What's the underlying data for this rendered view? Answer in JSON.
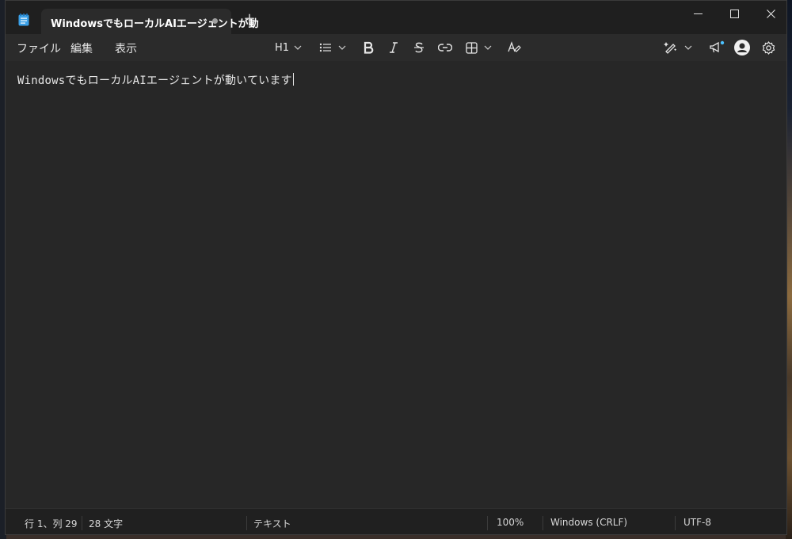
{
  "tab": {
    "title": "WindowsでもローカルAIエージェントが動"
  },
  "new_tab_label": "+",
  "menu": [
    "ファイル",
    "編集",
    "表示"
  ],
  "toolbar": {
    "heading_label": "H1"
  },
  "editor": {
    "text": "WindowsでもローカルAIエージェントが動いています"
  },
  "status": {
    "position": "行 1、列 29",
    "chars": "28 文字",
    "format": "テキスト",
    "zoom": "100%",
    "line_ending": "Windows (CRLF)",
    "encoding": "UTF-8"
  },
  "colors": {
    "background": "#272727",
    "titlebar": "#1f1f1f",
    "accent": "#4cc2ff",
    "text": "#e8e8e8"
  },
  "icons": [
    "notepad-icon",
    "unsaved-dot-icon",
    "minimize-icon",
    "maximize-icon",
    "close-icon",
    "chevron-down-icon",
    "bullet-list-icon",
    "bold-icon",
    "italic-icon",
    "strikethrough-icon",
    "link-icon",
    "table-icon",
    "clear-formatting-icon",
    "copilot-icon",
    "announcement-icon",
    "account-icon",
    "settings-icon"
  ]
}
